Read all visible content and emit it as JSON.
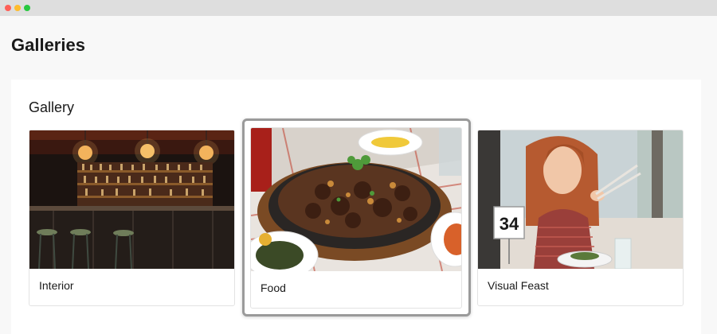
{
  "window": {
    "controls": [
      "close",
      "minimize",
      "maximize"
    ]
  },
  "page": {
    "title": "Galleries"
  },
  "gallery": {
    "heading": "Gallery",
    "items": [
      {
        "label": "Interior",
        "image": "bar-interior-photo"
      },
      {
        "label": "Food",
        "image": "sizzling-beef-platter-photo",
        "selected": true
      },
      {
        "label": "Visual Feast",
        "image": "woman-with-chopsticks-photo"
      }
    ],
    "table_number": "34"
  },
  "colors": {
    "selection_border": "#9a9a9a",
    "page_background": "#f8f8f8",
    "panel_background": "#ffffff"
  }
}
